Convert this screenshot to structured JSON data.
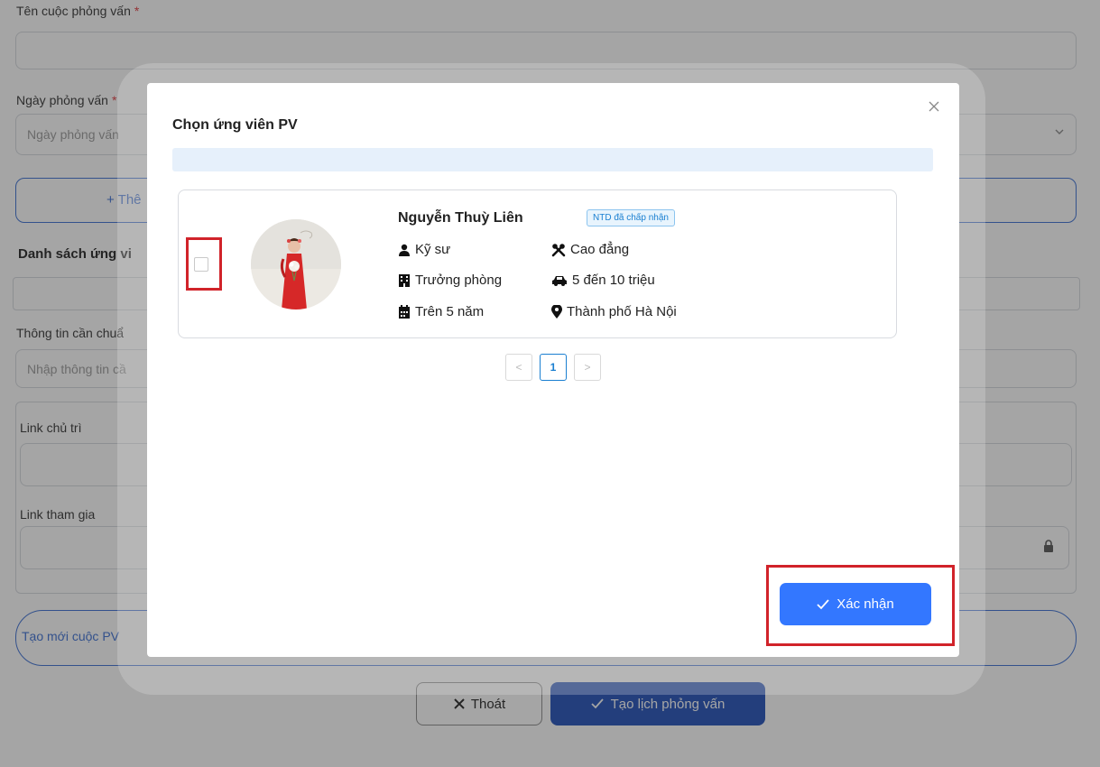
{
  "form": {
    "interview_name_label": "Tên cuộc phỏng vấn",
    "required_mark": "*",
    "interview_date_label": "Ngày phỏng vấn",
    "interview_date_placeholder": "Ngày phỏng vấn",
    "add_button_partial": "+ Thê",
    "candidate_list_title_partial": "Danh sách ứng vi",
    "info_prepare_label_partial": "Thông tin cần chuẩ",
    "info_prepare_placeholder_partial": "Nhập thông tin cầ",
    "host_link_label": "Link chủ trì",
    "join_link_label": "Link tham gia",
    "create_new_partial": "Tạo mới cuộc PV",
    "exit_button": "Thoát",
    "schedule_button": "Tạo lịch phỏng vấn"
  },
  "modal": {
    "title": "Chọn ứng viên PV",
    "candidate": {
      "name": "Nguyễn Thuỳ Liên",
      "status": "NTD đã chấp nhận",
      "position": "Kỹ sư",
      "education": "Cao đẳng",
      "level": "Trưởng phòng",
      "salary": "5 đến 10 triệu",
      "experience": "Trên 5 năm",
      "location": "Thành phố Hà Nội"
    },
    "pagination": {
      "prev": "<",
      "current": "1",
      "next": ">"
    },
    "confirm_button": "Xác nhận"
  },
  "colors": {
    "primary": "#3377ff",
    "dark_primary": "#1f4fb8",
    "highlight": "#d1232a",
    "badge": "#1a7fd1"
  }
}
